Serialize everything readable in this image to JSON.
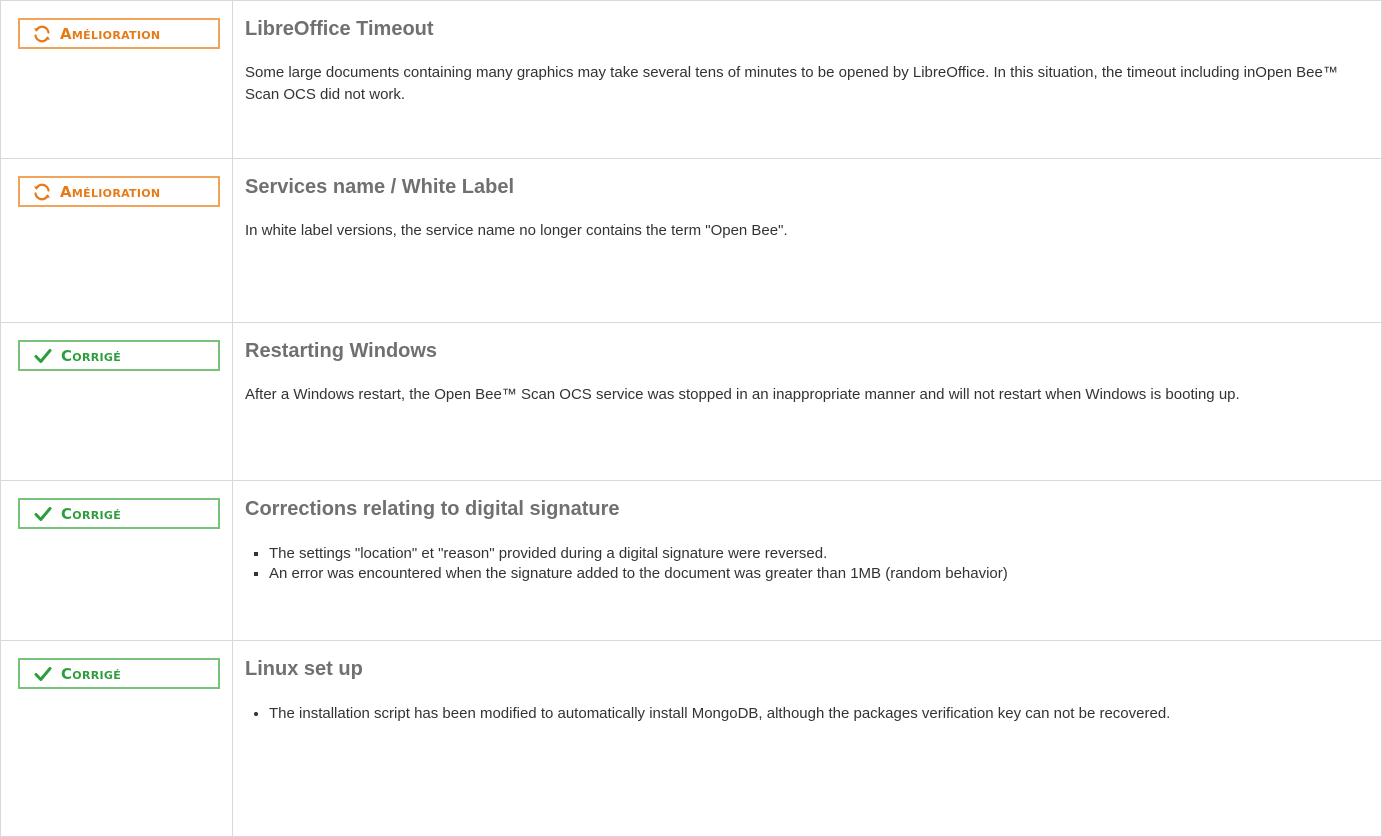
{
  "colors": {
    "improvement_accent": "#e87a16",
    "improvement_border": "#f0a45b",
    "fixed_accent": "#2e9e3c",
    "fixed_border": "#79c279",
    "title_color": "#707070"
  },
  "badges": {
    "improvement": {
      "label": "Amélioration",
      "icon": "refresh-icon"
    },
    "fixed": {
      "label": "Corrigé",
      "icon": "checkmark-icon"
    }
  },
  "items": [
    {
      "type": "improvement",
      "title": "LibreOffice Timeout",
      "description": "Some large documents containing many graphics may take several tens of minutes to be opened by LibreOffice. In this situation, the timeout including inOpen Bee™ Scan OCS did not work."
    },
    {
      "type": "improvement",
      "title": "Services name / White Label",
      "description": "In white label versions, the service name no longer contains the term \"Open Bee\"."
    },
    {
      "type": "fixed",
      "title": "Restarting Windows",
      "description": "After a Windows restart, the Open Bee™ Scan OCS service was stopped in an inappropriate manner and will not restart when Windows is booting up."
    },
    {
      "type": "fixed",
      "title": "Corrections relating to digital signature",
      "bullets": [
        "The settings \"location\" et \"reason\" provided during a digital signature were reversed.",
        "An error was encountered when the signature added to the document was greater than 1MB (random behavior)"
      ]
    },
    {
      "type": "fixed",
      "title": "Linux set up",
      "bullets": [
        "The installation script has been modified to automatically install MongoDB, although the packages verification key can not be recovered."
      ]
    }
  ]
}
